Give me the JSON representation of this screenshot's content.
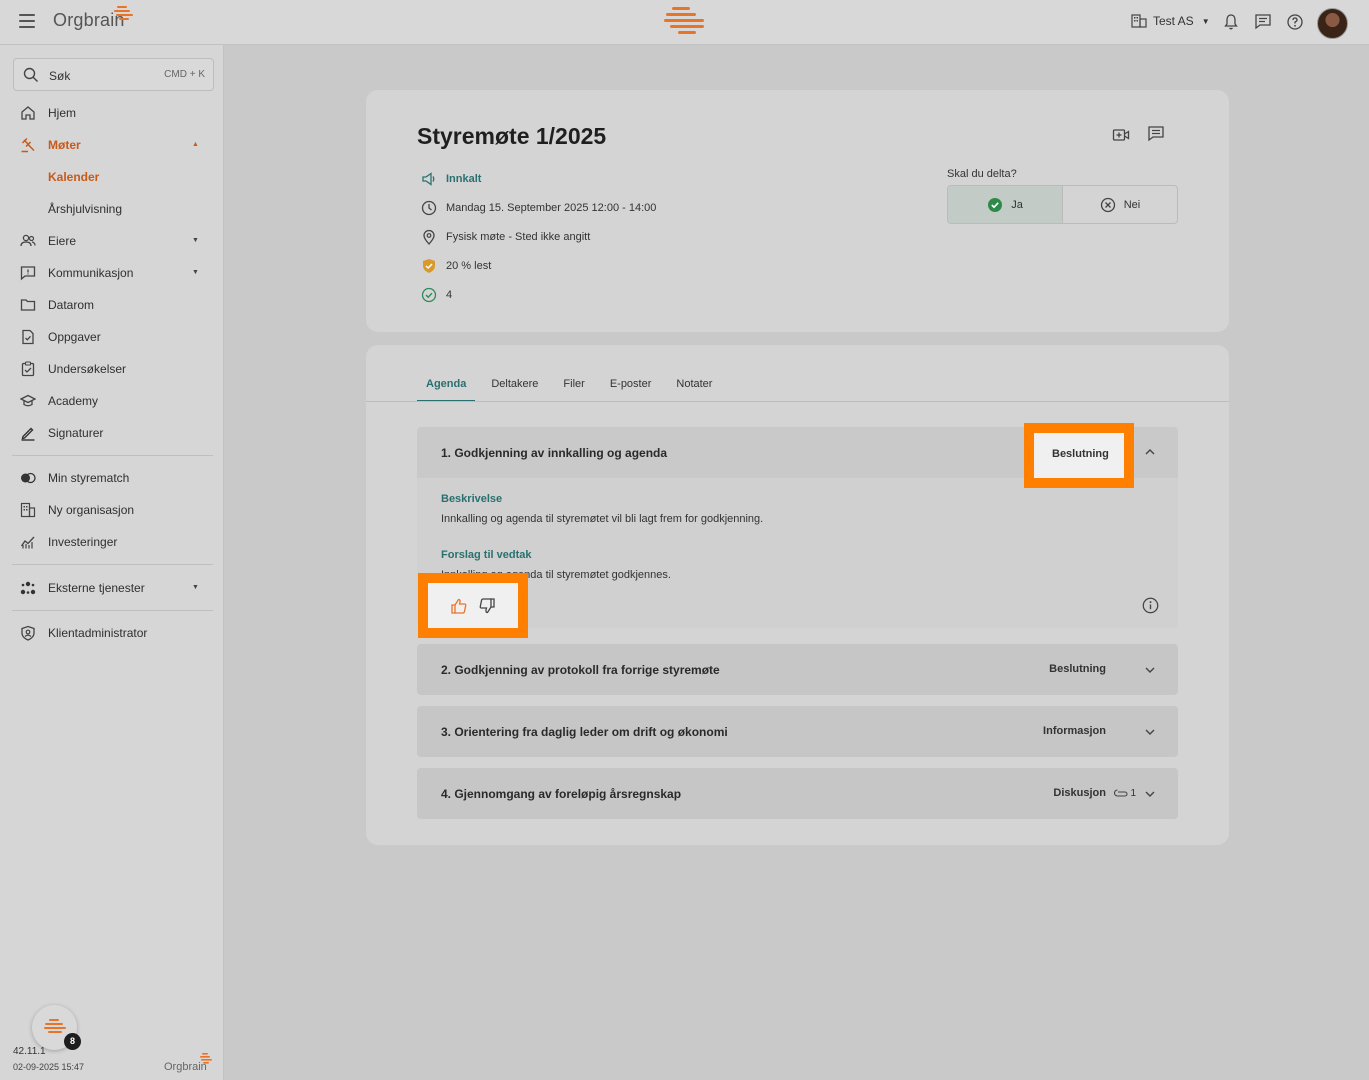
{
  "topbar": {
    "logo_text": "Orgbrain",
    "org_name": "Test AS"
  },
  "sidebar": {
    "search_placeholder": "Søk",
    "search_shortcut": "CMD + K",
    "items": [
      {
        "label": "Hjem"
      },
      {
        "label": "Møter"
      },
      {
        "label": "Kalender"
      },
      {
        "label": "Årshjulvisning"
      },
      {
        "label": "Eiere"
      },
      {
        "label": "Kommunikasjon"
      },
      {
        "label": "Datarom"
      },
      {
        "label": "Oppgaver"
      },
      {
        "label": "Undersøkelser"
      },
      {
        "label": "Academy"
      },
      {
        "label": "Signaturer"
      },
      {
        "label": "Min styrematch"
      },
      {
        "label": "Ny organisasjon"
      },
      {
        "label": "Investeringer"
      },
      {
        "label": "Eksterne tjenester"
      },
      {
        "label": "Klientadministrator"
      }
    ],
    "help_badge": "8",
    "version": "42.11.1",
    "timestamp": "02-09-2025 15:47",
    "footer_logo": "Orgbrain"
  },
  "meeting": {
    "title": "Styremøte 1/2025",
    "status": "Innkalt",
    "datetime": "Mandag 15. September 2025 12:00 - 14:00",
    "location": "Fysisk møte - Sted ikke angitt",
    "read": "20 % lest",
    "approved_count": "4",
    "attend_question": "Skal du delta?",
    "attend_yes": "Ja",
    "attend_no": "Nei"
  },
  "tabs": [
    "Agenda",
    "Deltakere",
    "Filer",
    "E-poster",
    "Notater"
  ],
  "agenda": [
    {
      "title": "1. Godkjenning av innkalling og agenda",
      "type": "Beslutning",
      "description_label": "Beskrivelse",
      "description": "Innkalling og agenda til styremøtet vil bli lagt frem for godkjenning.",
      "proposal_label": "Forslag til vedtak",
      "proposal": "Innkalling og agenda til styremøtet godkjennes."
    },
    {
      "title": "2. Godkjenning av protokoll fra forrige styremøte",
      "type": "Beslutning"
    },
    {
      "title": "3. Orientering fra daglig leder om drift og økonomi",
      "type": "Informasjon"
    },
    {
      "title": "4. Gjennomgang av foreløpig årsregnskap",
      "type": "Diskusjon",
      "attachments": "1"
    }
  ],
  "colors": {
    "accent": "#ff7f00",
    "teal": "#2a7070",
    "brand_orange": "#c85a1a"
  }
}
